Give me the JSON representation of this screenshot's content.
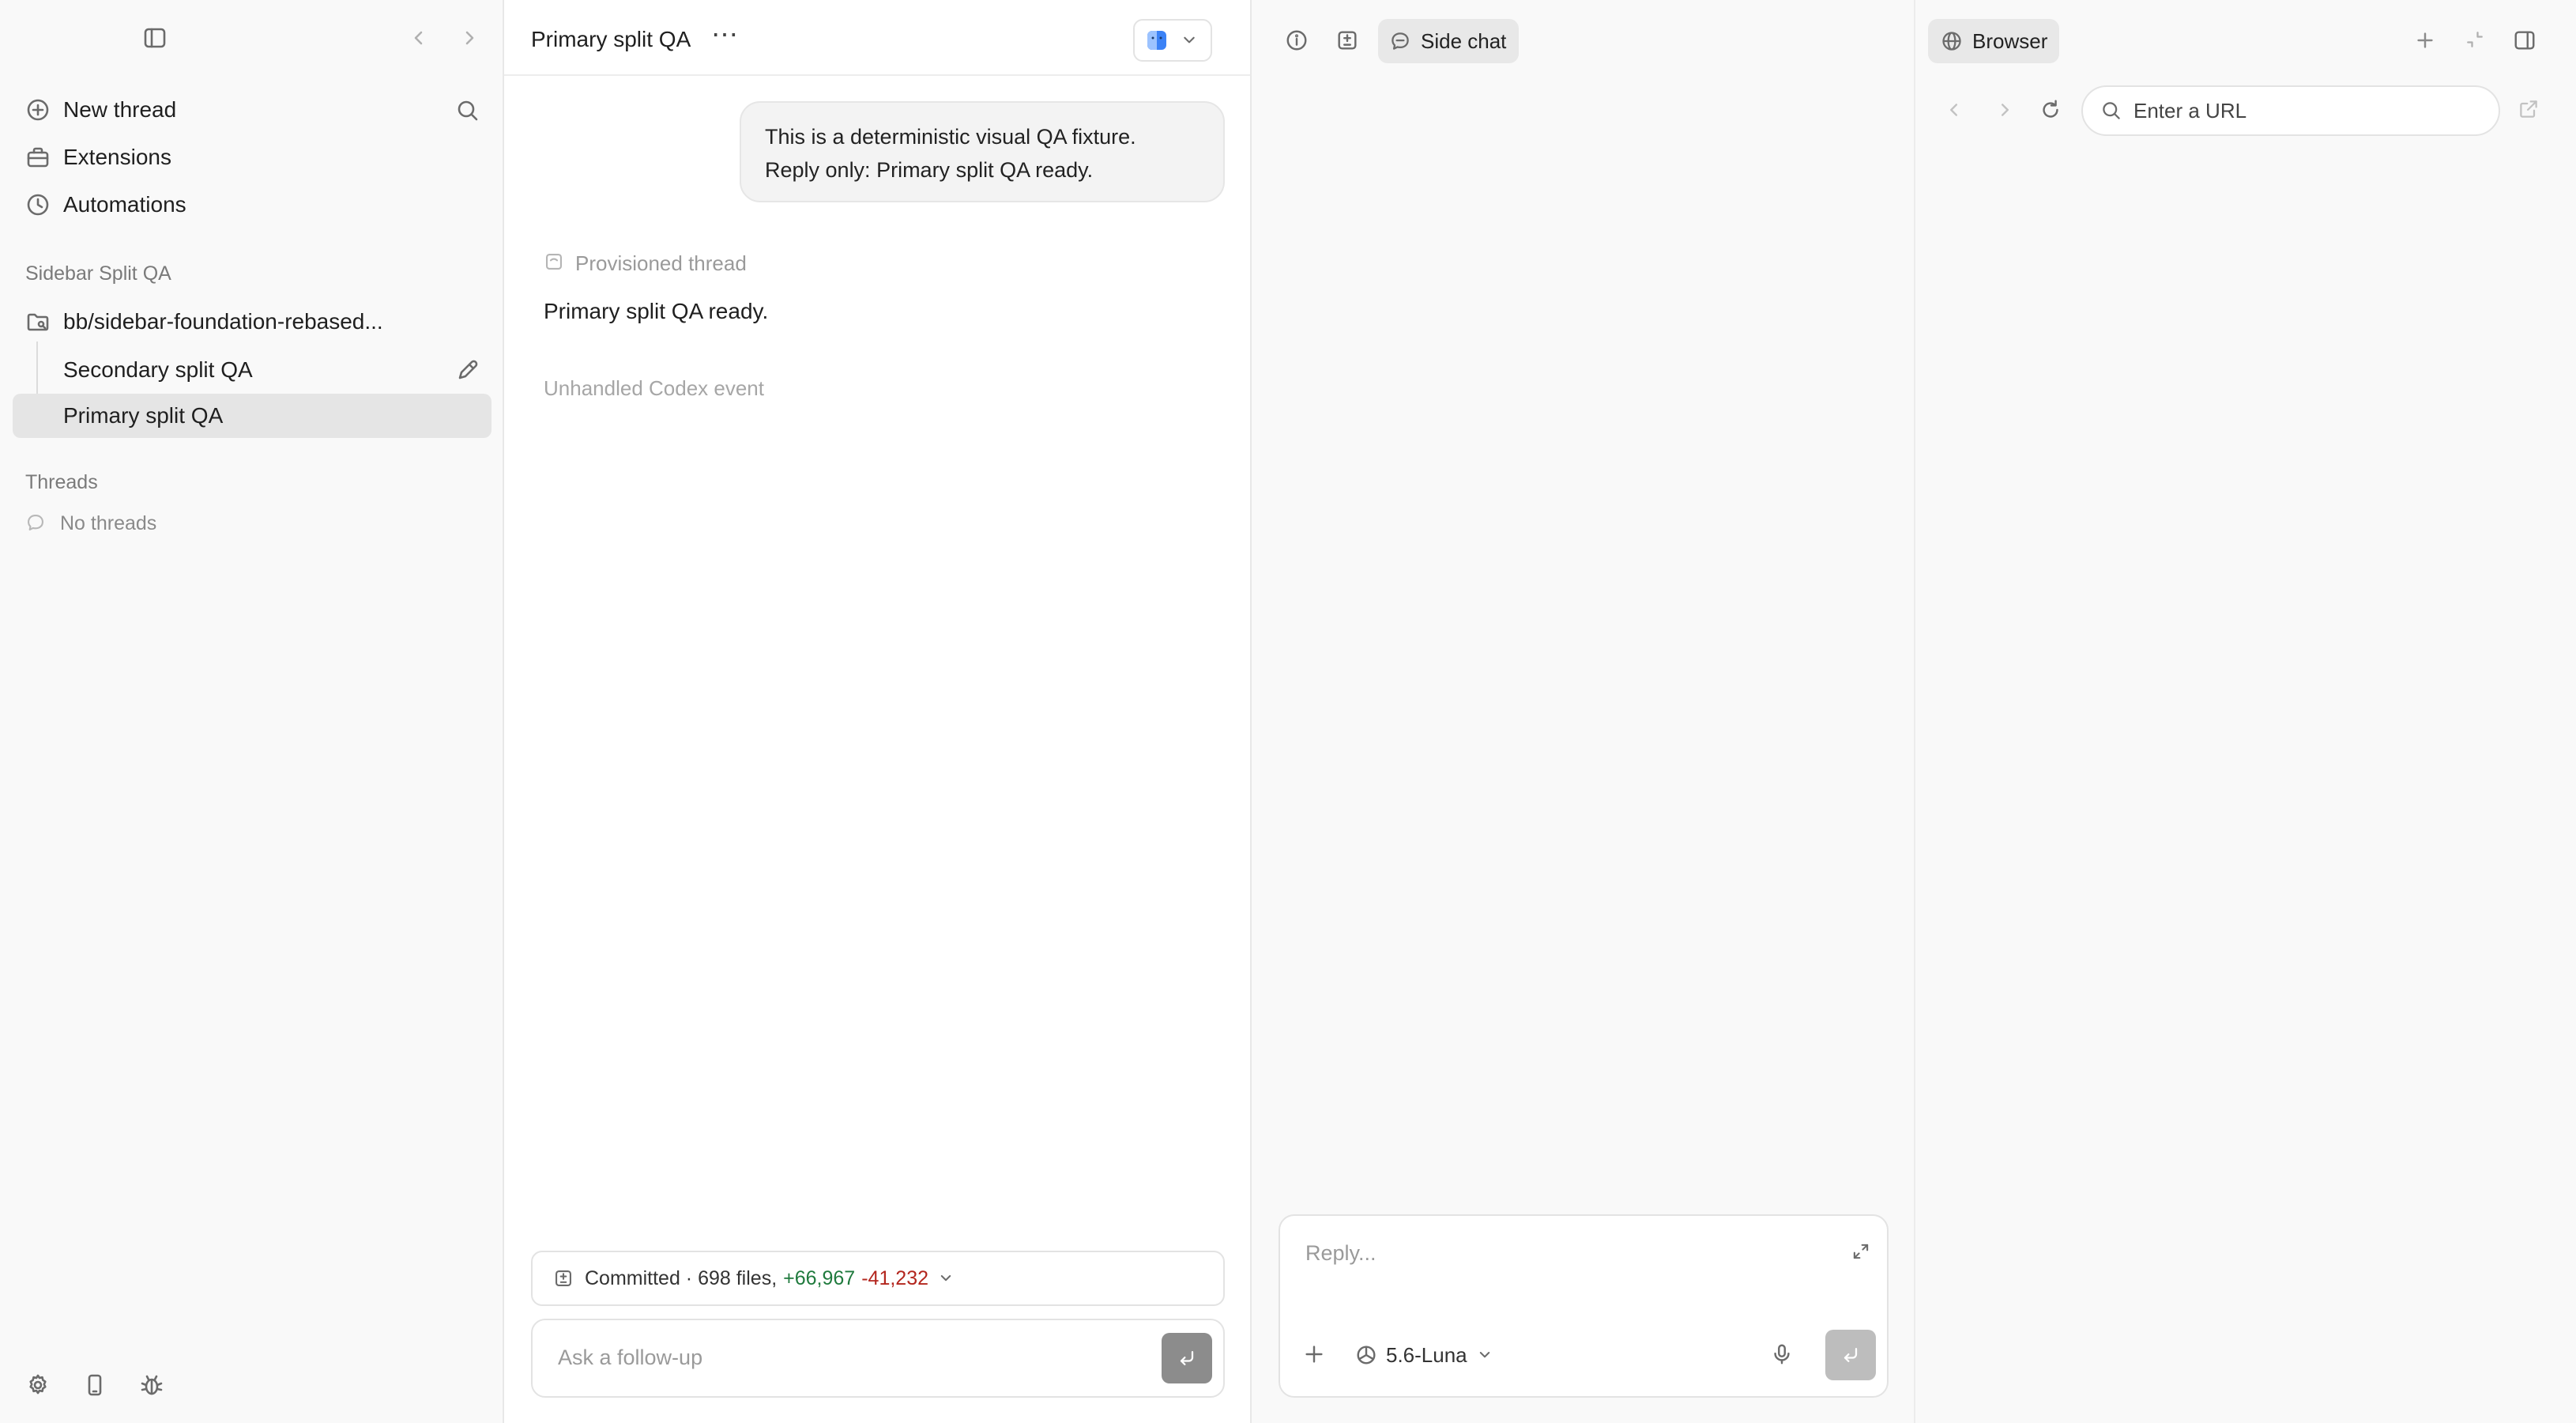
{
  "sidebar": {
    "nav": [
      {
        "label": "New thread",
        "icon": "plus-circle-icon"
      },
      {
        "label": "Extensions",
        "icon": "briefcase-icon"
      },
      {
        "label": "Automations",
        "icon": "clock-icon"
      }
    ],
    "project_section": "Sidebar Split QA",
    "project_folder": "bb/sidebar-foundation-rebased...",
    "threads": [
      "Secondary split QA",
      "Primary split QA"
    ],
    "threads_section": "Threads",
    "no_threads": "No threads"
  },
  "chat": {
    "title": "Primary split QA",
    "user_message_line1": "This is a deterministic visual QA fixture.",
    "user_message_line2": "Reply only: Primary split QA ready.",
    "provisioned": "Provisioned thread",
    "assistant_reply": "Primary split QA ready.",
    "unhandled_event": "Unhandled Codex event",
    "committed_label": "Committed · 698 files,",
    "additions": "+66,967",
    "deletions": "-41,232",
    "composer_placeholder": "Ask a follow-up"
  },
  "sidechat": {
    "tab_label": "Side chat",
    "reply_placeholder": "Reply...",
    "model": "5.6-Luna"
  },
  "browser": {
    "tab_label": "Browser",
    "url_placeholder": "Enter a URL"
  },
  "colors": {
    "additions": "#1f7a3d",
    "deletions": "#b3261e",
    "active_row": "#e5e5e5"
  }
}
